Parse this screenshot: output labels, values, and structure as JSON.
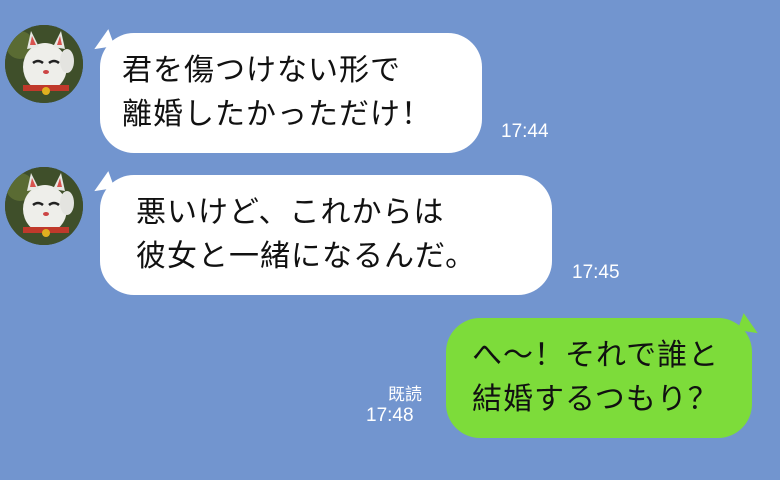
{
  "messages": [
    {
      "side": "in",
      "lines": [
        "君を傷つけない形で",
        "離婚したかっただけ！"
      ],
      "time": "17:44"
    },
    {
      "side": "in",
      "lines": [
        "悪いけど、これからは",
        "彼女と一緒になるんだ。"
      ],
      "time": "17:45"
    },
    {
      "side": "out",
      "lines": [
        "へ〜！それで誰と",
        "結婚するつもり？"
      ],
      "time": "17:48",
      "read": "既読"
    }
  ],
  "colors": {
    "background": "#7295cf",
    "incoming": "#ffffff",
    "outgoing": "#7ddc3a"
  },
  "avatar_icon": "lucky-cat-avatar-icon"
}
